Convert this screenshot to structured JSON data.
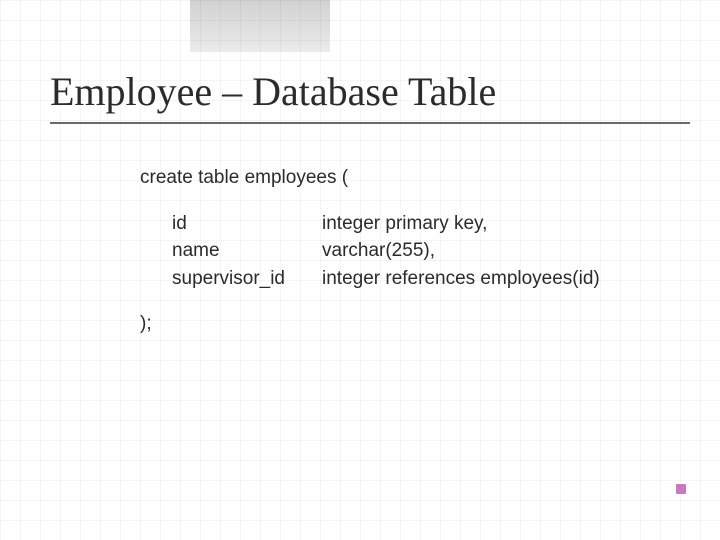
{
  "slide": {
    "title": "Employee – Database Table",
    "sql_open": "create table employees (",
    "columns": [
      {
        "name": "id",
        "definition": "integer primary key,"
      },
      {
        "name": "name",
        "definition": "varchar(255),"
      },
      {
        "name": "supervisor_id",
        "definition": "integer references employees(id)"
      }
    ],
    "sql_close": ");"
  }
}
